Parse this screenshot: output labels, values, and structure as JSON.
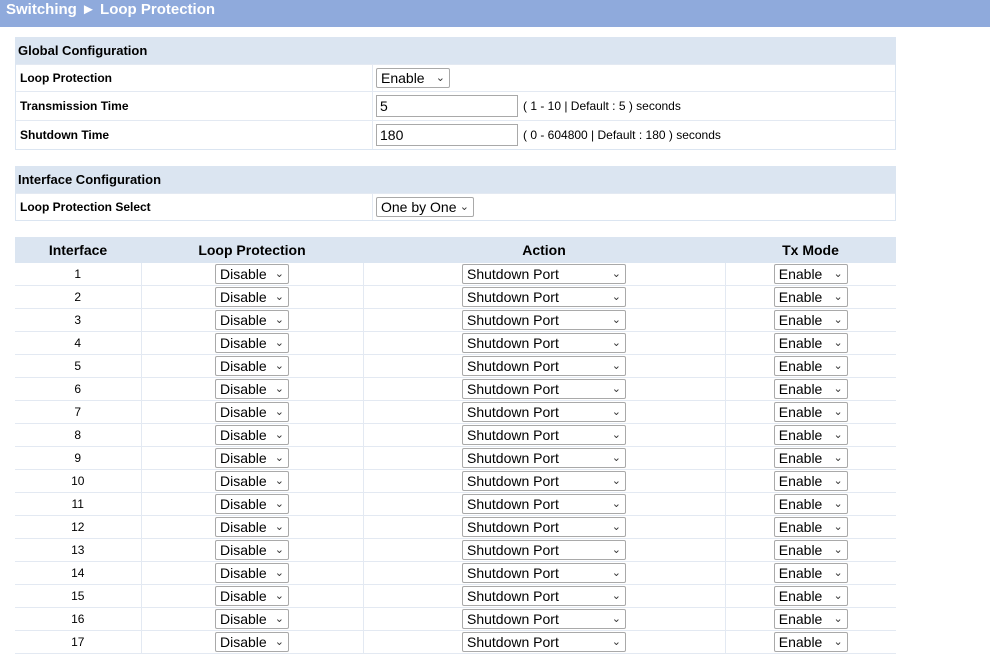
{
  "breadcrumb": {
    "section": "Switching",
    "separator": "►",
    "page": "Loop Protection"
  },
  "global": {
    "heading": "Global Configuration",
    "loop_protection_label": "Loop Protection",
    "loop_protection_value": "Enable",
    "transmission_time_label": "Transmission Time",
    "transmission_time_value": "5",
    "transmission_time_hint": "( 1 - 10 | Default : 5 ) seconds",
    "shutdown_time_label": "Shutdown Time",
    "shutdown_time_value": "180",
    "shutdown_time_hint": "( 0 - 604800 | Default : 180 ) seconds"
  },
  "interface_config": {
    "heading": "Interface Configuration",
    "select_label": "Loop Protection Select",
    "select_value": "One by One"
  },
  "ports_table": {
    "headers": [
      "Interface",
      "Loop Protection",
      "Action",
      "Tx Mode"
    ],
    "rows": [
      {
        "interface": "1",
        "loop_protection": "Disable",
        "action": "Shutdown Port",
        "tx_mode": "Enable"
      },
      {
        "interface": "2",
        "loop_protection": "Disable",
        "action": "Shutdown Port",
        "tx_mode": "Enable"
      },
      {
        "interface": "3",
        "loop_protection": "Disable",
        "action": "Shutdown Port",
        "tx_mode": "Enable"
      },
      {
        "interface": "4",
        "loop_protection": "Disable",
        "action": "Shutdown Port",
        "tx_mode": "Enable"
      },
      {
        "interface": "5",
        "loop_protection": "Disable",
        "action": "Shutdown Port",
        "tx_mode": "Enable"
      },
      {
        "interface": "6",
        "loop_protection": "Disable",
        "action": "Shutdown Port",
        "tx_mode": "Enable"
      },
      {
        "interface": "7",
        "loop_protection": "Disable",
        "action": "Shutdown Port",
        "tx_mode": "Enable"
      },
      {
        "interface": "8",
        "loop_protection": "Disable",
        "action": "Shutdown Port",
        "tx_mode": "Enable"
      },
      {
        "interface": "9",
        "loop_protection": "Disable",
        "action": "Shutdown Port",
        "tx_mode": "Enable"
      },
      {
        "interface": "10",
        "loop_protection": "Disable",
        "action": "Shutdown Port",
        "tx_mode": "Enable"
      },
      {
        "interface": "11",
        "loop_protection": "Disable",
        "action": "Shutdown Port",
        "tx_mode": "Enable"
      },
      {
        "interface": "12",
        "loop_protection": "Disable",
        "action": "Shutdown Port",
        "tx_mode": "Enable"
      },
      {
        "interface": "13",
        "loop_protection": "Disable",
        "action": "Shutdown Port",
        "tx_mode": "Enable"
      },
      {
        "interface": "14",
        "loop_protection": "Disable",
        "action": "Shutdown Port",
        "tx_mode": "Enable"
      },
      {
        "interface": "15",
        "loop_protection": "Disable",
        "action": "Shutdown Port",
        "tx_mode": "Enable"
      },
      {
        "interface": "16",
        "loop_protection": "Disable",
        "action": "Shutdown Port",
        "tx_mode": "Enable"
      },
      {
        "interface": "17",
        "loop_protection": "Disable",
        "action": "Shutdown Port",
        "tx_mode": "Enable"
      }
    ]
  },
  "icons": {
    "dropdown": "chevron-down-icon",
    "breadcrumb_separator": "triangle-right-icon"
  },
  "colors": {
    "title_bar": "#8faadc",
    "section_header": "#dbe5f1",
    "row_border": "#e3e9f2"
  }
}
